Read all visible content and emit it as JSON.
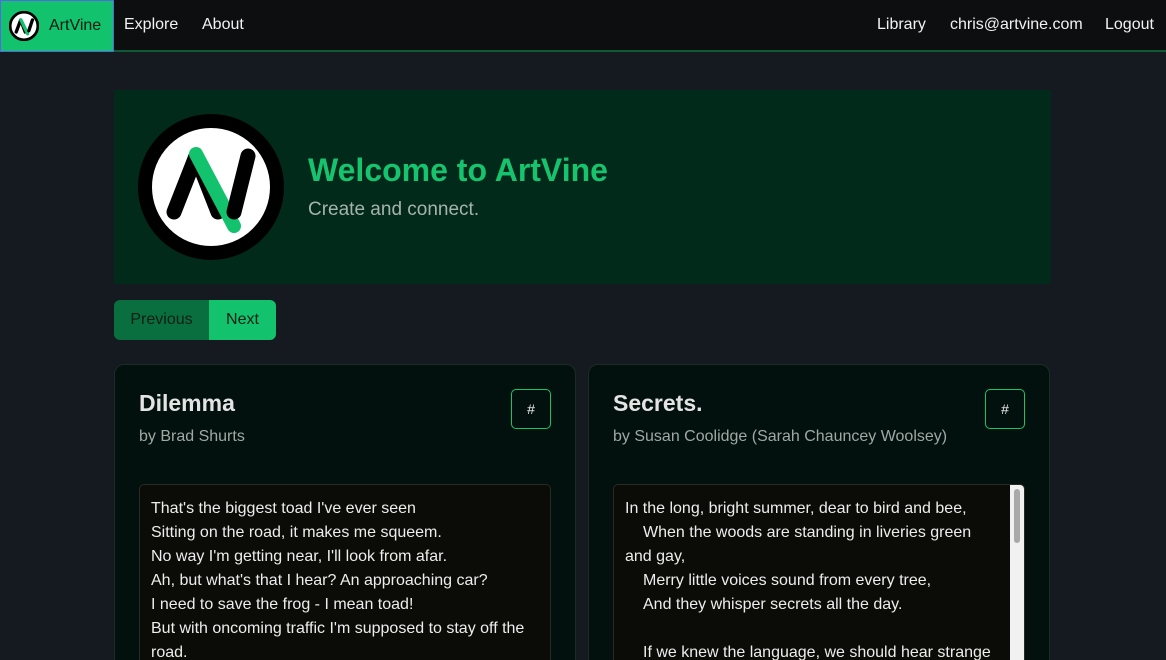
{
  "nav": {
    "brand": "ArtVine",
    "links_left": [
      "Explore",
      "About"
    ],
    "library": "Library",
    "user_email": "chris@artvine.com",
    "logout": "Logout"
  },
  "hero": {
    "title": "Welcome to ArtVine",
    "subtitle": "Create and connect."
  },
  "pager": {
    "previous": "Previous",
    "next": "Next"
  },
  "cards": [
    {
      "title": "Dilemma",
      "author": "by Brad Shurts",
      "hash": "#",
      "lines": [
        "That's the biggest toad I've ever seen",
        "Sitting on the road, it makes me squeem.",
        "No way I'm getting near, I'll look from afar.",
        "Ah, but what's that I hear? An approaching car?",
        "I need to save the frog - I mean toad!",
        "But with oncoming traffic I'm supposed to stay off the road."
      ]
    },
    {
      "title": "Secrets.",
      "author": "by Susan Coolidge (Sarah Chauncey Woolsey)",
      "hash": "#",
      "lines": [
        "In the long, bright summer, dear to bird and bee,",
        "When the woods are standing in liveries green and gay,",
        "Merry little voices sound from every tree,",
        "And they whisper secrets all the day.",
        "",
        "If we knew the language, we should hear strange"
      ]
    }
  ],
  "colors": {
    "accent": "#12c26c",
    "hero_bg": "#012a1b",
    "page_bg": "#141a1f"
  }
}
